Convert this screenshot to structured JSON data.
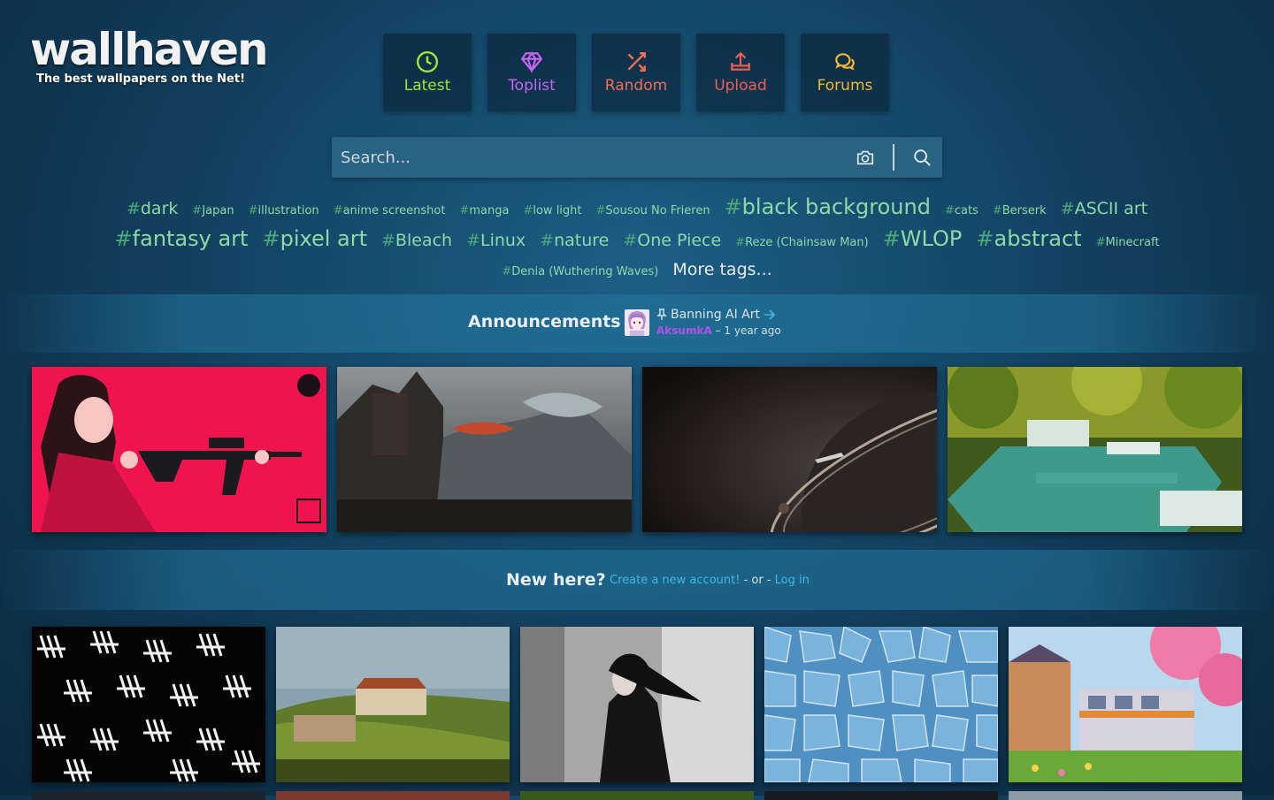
{
  "logo": {
    "title": "wallhaven",
    "tagline": "The best wallpapers on the Net!"
  },
  "nav": [
    {
      "label": "Latest",
      "icon": "clock-icon",
      "color": "#a3e635"
    },
    {
      "label": "Toplist",
      "icon": "diamond-icon",
      "color": "#c465f0"
    },
    {
      "label": "Random",
      "icon": "shuffle-icon",
      "color": "#ee6e55"
    },
    {
      "label": "Upload",
      "icon": "upload-icon",
      "color": "#ee6055"
    },
    {
      "label": "Forums",
      "icon": "chat-bubbles-icon",
      "color": "#f5b731"
    }
  ],
  "search": {
    "placeholder": "Search..."
  },
  "tags": {
    "row1": [
      "dark",
      "Japan",
      "illustration",
      "anime screenshot",
      "manga",
      "low light",
      "Sousou No Frieren",
      "black background",
      "cats",
      "Berserk",
      "ASCII art"
    ],
    "row2": [
      "fantasy art",
      "pixel art",
      "Bleach",
      "Linux",
      "nature",
      "One Piece",
      "Reze (Chainsaw Man)",
      "WLOP",
      "abstract",
      "Minecraft"
    ],
    "row3": [
      "Denia (Wuthering Waves)"
    ],
    "more": "More tags..."
  },
  "announcements": {
    "title": "Announcements",
    "post_title": "Banning AI Art",
    "author": "AksumkA",
    "time": "1 year ago"
  },
  "featured": [
    {
      "name": "anime girl with rifle on red background"
    },
    {
      "name": "dragon over mountain temple"
    },
    {
      "name": "ringed planet in space"
    },
    {
      "name": "jungle waterfall pools"
    }
  ],
  "new_here": {
    "title": "New here?",
    "signup": "Create a new account!",
    "or": " - or - ",
    "login": "Log in"
  },
  "latest": [
    {
      "name": "black and white tally pattern"
    },
    {
      "name": "castle landscape painting"
    },
    {
      "name": "woman in black with flowing hair"
    },
    {
      "name": "blue cracked tile texture"
    },
    {
      "name": "train with cherry blossoms"
    }
  ],
  "colors": {
    "tag": "#8fd9a8",
    "link": "#42b7e0",
    "author": "#b452e8"
  }
}
